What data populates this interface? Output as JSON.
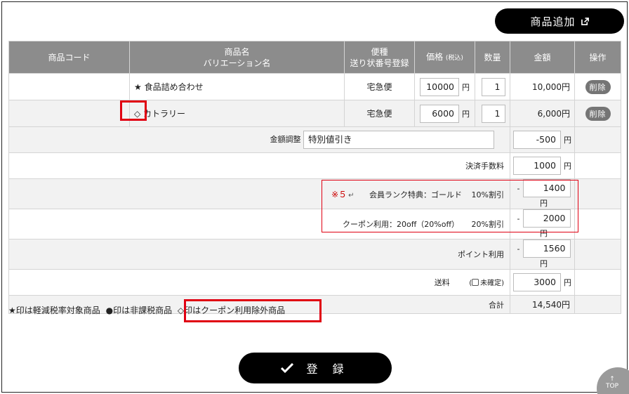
{
  "toolbar": {
    "add_product_label": "商品追加"
  },
  "table": {
    "headers": {
      "code": "商品コード",
      "name_line1": "商品名",
      "name_line2": "バリエーション名",
      "ship_line1": "便種",
      "ship_line2": "送り状番号登録",
      "price": "価格",
      "price_note": "(税込)",
      "qty": "数量",
      "amount": "金額",
      "action": "操作"
    },
    "rows": [
      {
        "code": "",
        "name": "★ 食品詰め合わせ",
        "shipping": "宅急便",
        "price": "10000",
        "qty": "1",
        "amount": "10,000円",
        "delete": "削除"
      },
      {
        "code": "",
        "name": "◇ カトラリー",
        "shipping": "宅急便",
        "price": "6000",
        "qty": "1",
        "amount": "6,000円",
        "delete": "削除"
      }
    ],
    "yen": "円"
  },
  "summary": {
    "adjust_label": "金額調整",
    "adjust_value": "特別値引き",
    "adjust_amount": "-500",
    "fee_label": "決済手数料",
    "fee_amount": "1000",
    "note_mark": "※５",
    "return_mark": "↵",
    "member_label": "会員ランク特典：ゴールド",
    "member_rate": "10%割引",
    "member_amount": "1400",
    "coupon_label": "クーポン利用：20off（20%off）",
    "coupon_rate": "20%割引",
    "coupon_amount": "2000",
    "minus": "-",
    "point_label": "ポイント利用",
    "point_amount": "1560",
    "shipping_label": "送料",
    "undecided_label": "未確定)",
    "undecided_open": "(",
    "shipping_amount": "3000",
    "total_label": "合計",
    "total_amount": "14,540円"
  },
  "legend": {
    "reduced": "★印は軽減税率対象商品",
    "nontax": "●印は非課税商品",
    "coupon_excluded": "◇印はクーポン利用除外商品"
  },
  "footer": {
    "submit_label": "登 録",
    "top_label": "TOP",
    "top_arrow": "↑"
  },
  "colors": {
    "header_bg": "#8c8c8c",
    "highlight": "#e00012",
    "button": "#000000"
  }
}
